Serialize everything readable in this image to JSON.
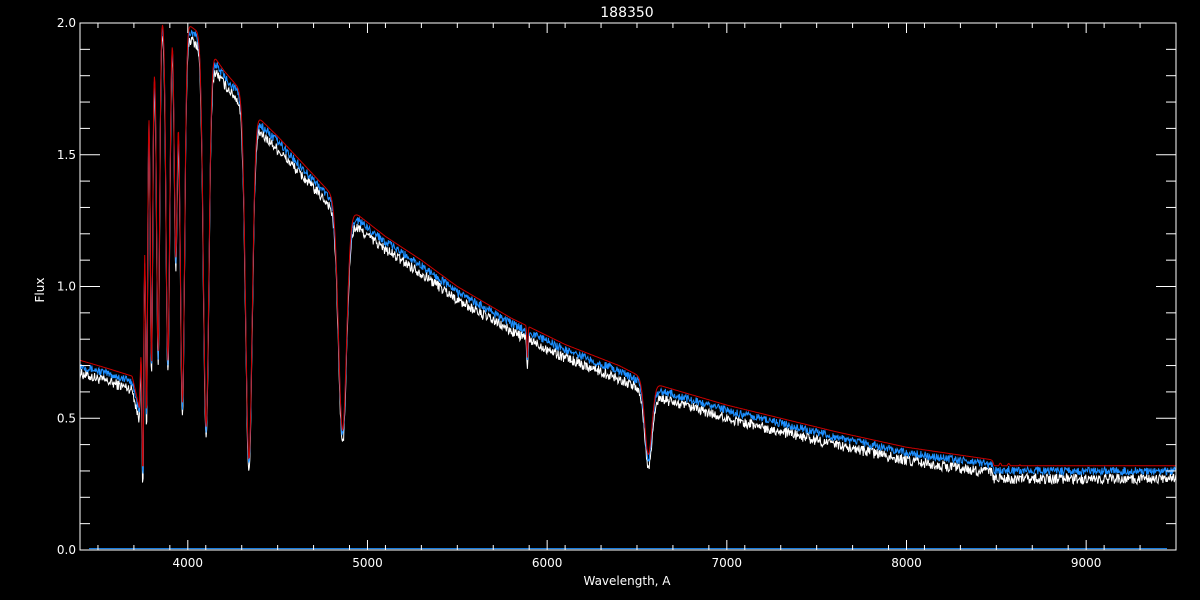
{
  "chart_data": {
    "type": "line",
    "title": "188350",
    "xlabel": "Wavelength, A",
    "ylabel": "Flux",
    "xlim": [
      3400,
      9500
    ],
    "ylim": [
      0.0,
      2.0
    ],
    "grid": false,
    "x_ticks": [
      4000,
      5000,
      6000,
      7000,
      8000,
      9000
    ],
    "x_tick_labels": [
      "4000",
      "5000",
      "6000",
      "7000",
      "8000",
      "9000"
    ],
    "y_ticks": [
      0.0,
      0.5,
      1.0,
      1.5,
      2.0
    ],
    "y_tick_labels": [
      "0.0",
      "0.5",
      "1.0",
      "1.5",
      "2.0"
    ],
    "colors": {
      "background": "#000000",
      "axes": "#ffffff",
      "white_series": "#ffffff",
      "blue_series": "#1e8fff",
      "red_series": "#cc0000"
    },
    "continuum": {
      "x": [
        3400,
        3550,
        3690,
        3730,
        3780,
        3850,
        3950,
        4050,
        4120,
        4200,
        4300,
        4380,
        4500,
        4650,
        4800,
        4880,
        4950,
        5100,
        5300,
        5500,
        5800,
        6100,
        6400,
        6600,
        6800,
        7000,
        7300,
        7600,
        8000,
        8300,
        8600,
        9000,
        9300,
        9500
      ],
      "y": [
        0.7,
        0.67,
        0.64,
        0.52,
        1.7,
        2.0,
        2.0,
        1.95,
        1.88,
        1.8,
        1.72,
        1.63,
        1.55,
        1.44,
        1.33,
        1.27,
        1.25,
        1.17,
        1.08,
        0.98,
        0.86,
        0.76,
        0.68,
        0.61,
        0.57,
        0.53,
        0.48,
        0.43,
        0.37,
        0.34,
        0.31,
        0.27,
        0.25,
        0.25
      ]
    },
    "absorption_lines": [
      {
        "x": 3750,
        "depth": 0.9,
        "width": 4
      },
      {
        "x": 3771,
        "depth": 1.0,
        "width": 5
      },
      {
        "x": 3798,
        "depth": 1.1,
        "width": 6
      },
      {
        "x": 3835,
        "depth": 1.2,
        "width": 8
      },
      {
        "x": 3889,
        "depth": 1.3,
        "width": 10
      },
      {
        "x": 3933,
        "depth": 0.9,
        "width": 8
      },
      {
        "x": 3970,
        "depth": 1.45,
        "width": 12
      },
      {
        "x": 4102,
        "depth": 1.45,
        "width": 15
      },
      {
        "x": 4340,
        "depth": 1.35,
        "width": 18
      },
      {
        "x": 4861,
        "depth": 0.85,
        "width": 22
      },
      {
        "x": 5890,
        "depth": 0.12,
        "width": 3
      },
      {
        "x": 6563,
        "depth": 0.28,
        "width": 20
      },
      {
        "x": 8500,
        "depth": 0.05,
        "width": 10
      },
      {
        "x": 8545,
        "depth": 0.05,
        "width": 10
      },
      {
        "x": 8600,
        "depth": 0.07,
        "width": 12
      },
      {
        "x": 8665,
        "depth": 0.08,
        "width": 12
      },
      {
        "x": 8750,
        "depth": 0.09,
        "width": 14
      },
      {
        "x": 8863,
        "depth": 0.1,
        "width": 15
      },
      {
        "x": 9015,
        "depth": 0.12,
        "width": 18
      },
      {
        "x": 9229,
        "depth": 0.1,
        "width": 18
      }
    ],
    "series": [
      {
        "color_key": "white_series",
        "offset": -0.03,
        "noise": 0.02
      },
      {
        "color_key": "blue_series",
        "offset": 0.0,
        "noise": 0.015
      },
      {
        "color_key": "red_series",
        "offset": 0.02,
        "noise": 0.0
      }
    ]
  }
}
